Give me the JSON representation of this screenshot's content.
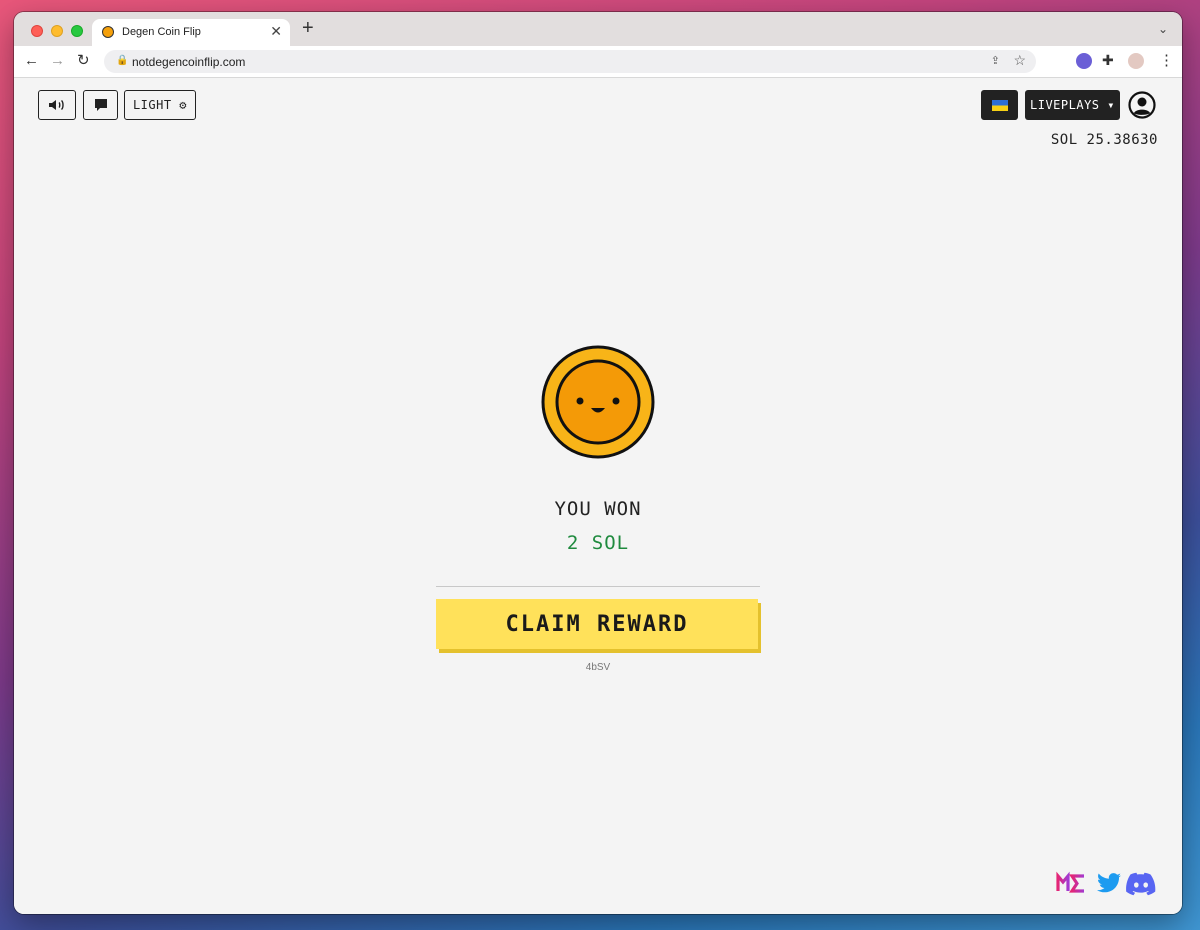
{
  "browser": {
    "tab_title": "Degen Coin Flip",
    "tab_close": "✕",
    "new_tab": "+",
    "tab_menu": "⌄",
    "url": "notdegencoinflip.com"
  },
  "header": {
    "sound_icon": "speaker-icon",
    "chat_icon": "chat-icon",
    "theme_label": "LIGHT ⚙",
    "language_flag": "ukraine-flag",
    "liveplays_label": "LIVEPLAYS ▾",
    "balance": "SOL 25.38630"
  },
  "result": {
    "headline": "YOU WON",
    "amount": "2 SOL",
    "claim_label": "CLAIM REWARD",
    "code": "4bSV"
  },
  "footer": {
    "social": [
      "magic-eden-icon",
      "twitter-icon",
      "discord-icon"
    ]
  },
  "colors": {
    "accent_yellow": "#ffe15a",
    "coin_orange": "#f5a00b",
    "win_green": "#1f8a3e",
    "dark_button": "#222222"
  }
}
